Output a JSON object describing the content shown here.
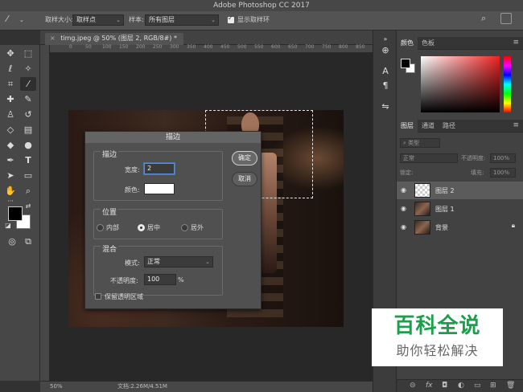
{
  "app": {
    "window_title": "Adobe Photoshop CC 2017"
  },
  "options_bar": {
    "sample_size_label": "取样大小:",
    "sample_size_value": "取样点",
    "sample_label": "样本:",
    "sample_value": "所有图层",
    "show_ring_label": "显示取样环"
  },
  "document": {
    "tab_label": "timg.jpeg @ 50% (图层 2, RGB/8#) *",
    "zoom": "50%",
    "doc_size": "文档:2.26M/4.51M"
  },
  "ruler": {
    "ticks": [
      "0",
      "50",
      "100",
      "150",
      "200",
      "250",
      "300",
      "350",
      "400",
      "450",
      "500",
      "550",
      "600",
      "650",
      "700",
      "750",
      "800",
      "850"
    ]
  },
  "color_panel": {
    "tabs": [
      "颜色",
      "色板"
    ]
  },
  "layers_panel": {
    "tabs": [
      "图层",
      "通道",
      "路径"
    ],
    "filter_label": "类型",
    "blend_mode": "正常",
    "opacity_label": "不透明度:",
    "opacity_value": "100%",
    "lock_label": "锁定:",
    "fill_label": "填充:",
    "fill_value": "100%",
    "layers": [
      {
        "name": "图层 2",
        "selected": true
      },
      {
        "name": "图层 1",
        "selected": false
      },
      {
        "name": "背景",
        "selected": false,
        "locked": true
      }
    ]
  },
  "stroke_dialog": {
    "title": "描边",
    "stroke_group": "描边",
    "width_label": "宽度:",
    "width_value": "2",
    "color_label": "颜色:",
    "color_value": "#ffffff",
    "position_group": "位置",
    "positions": [
      "内部",
      "居中",
      "居外"
    ],
    "selected_position": "居中",
    "blend_group": "混合",
    "mode_label": "模式:",
    "mode_value": "正常",
    "opacity_label": "不透明度:",
    "opacity_value": "100",
    "opacity_unit": "%",
    "preserve_transparency_label": "保留透明区域",
    "preserve_transparency_checked": false,
    "ok_label": "确定",
    "cancel_label": "取消"
  },
  "watermark": {
    "title": "百科全说",
    "subtitle": "助你轻松解决"
  },
  "colors": {
    "accent_green": "#1aa04a",
    "foreground": "#000000",
    "background": "#ffffff"
  }
}
